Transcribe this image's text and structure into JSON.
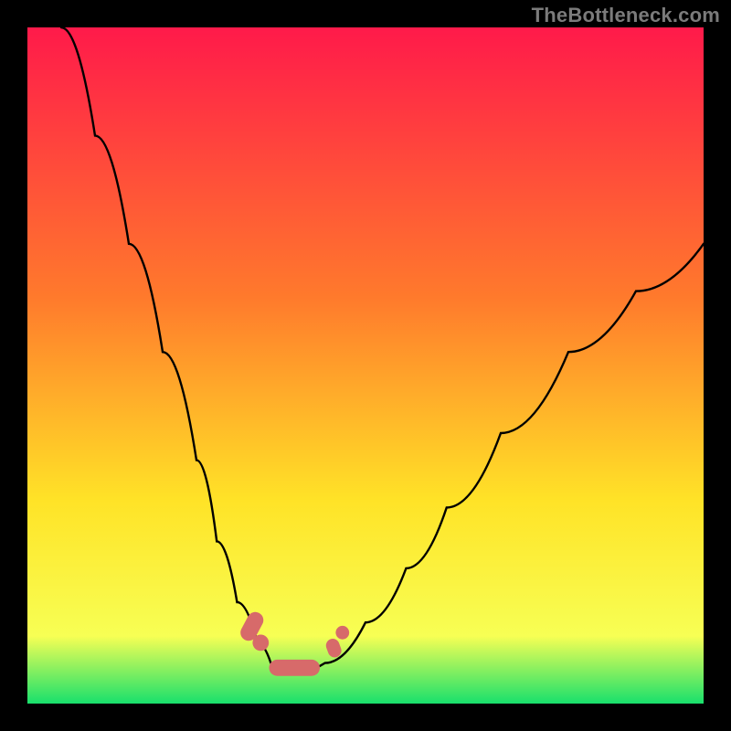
{
  "attribution": "TheBottleneck.com",
  "colors": {
    "frame": "#000000",
    "gradient_top": "#ff1a4a",
    "gradient_upper_mid": "#ff7a2c",
    "gradient_mid": "#ffe327",
    "gradient_lowband_top": "#f7ff54",
    "gradient_bottom": "#18e06c",
    "curve": "#000000",
    "marker": "#d76a6a"
  },
  "chart_data": {
    "type": "line",
    "title": "",
    "xlabel": "",
    "ylabel": "",
    "xlim": [
      0,
      100
    ],
    "ylim": [
      0,
      100
    ],
    "note": "Single V-shaped curve; y ≈ bottleneck %, vertex is the balanced point. x/y are percentages of plot area read from the figure (origin at bottom-left).",
    "series": [
      {
        "name": "bottleneck-curve",
        "x": [
          5,
          10,
          15,
          20,
          25,
          28,
          31,
          34,
          36,
          37.5,
          41,
          44,
          50,
          56,
          62,
          70,
          80,
          90,
          100
        ],
        "y": [
          100,
          84,
          68,
          52,
          36,
          24,
          15,
          9,
          6,
          5,
          5,
          6,
          12,
          20,
          29,
          40,
          52,
          61,
          68
        ]
      }
    ],
    "markers": [
      {
        "name": "left-cluster",
        "shape": "capsule",
        "x": 33.2,
        "y": 11.4,
        "angle_deg": -62,
        "length": 4.5,
        "width": 2.4
      },
      {
        "name": "left-cluster-dot",
        "shape": "dot",
        "x": 34.5,
        "y": 9.0,
        "r": 1.2
      },
      {
        "name": "bottom-bar",
        "shape": "capsule",
        "x": 39.5,
        "y": 5.3,
        "angle_deg": 0,
        "length": 7.5,
        "width": 2.4
      },
      {
        "name": "right-capsule",
        "shape": "capsule",
        "x": 45.3,
        "y": 8.2,
        "angle_deg": 70,
        "length": 2.8,
        "width": 2.0
      },
      {
        "name": "right-dot",
        "shape": "dot",
        "x": 46.6,
        "y": 10.5,
        "r": 1.0
      }
    ]
  }
}
